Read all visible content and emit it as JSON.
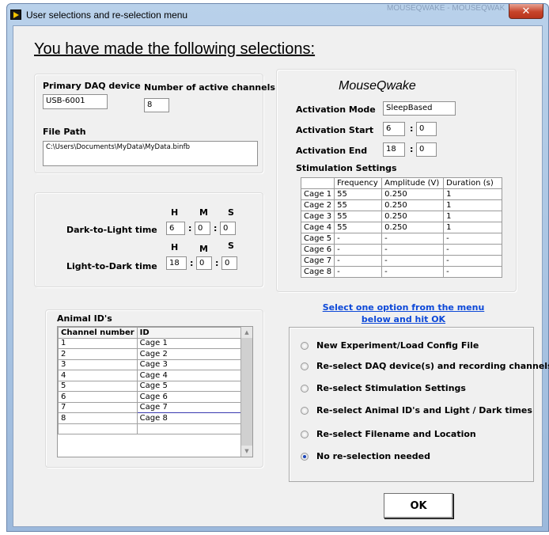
{
  "window": {
    "title": "User selections and re-selection menu",
    "background_title": "MOUSEQWAKE - MOUSEQWAKE.lvproj/..."
  },
  "heading": "You have made the following selections:",
  "daq": {
    "primary_label": "Primary DAQ device",
    "primary_value": "USB-6001",
    "channels_label": "Number of active channels",
    "channels_value": "8",
    "filepath_label": "File Path",
    "filepath_value": "C:\\Users\\Documents\\MyData\\MyData.binfb"
  },
  "times": {
    "h": "H",
    "m": "M",
    "s": "S",
    "dark_to_light_label": "Dark-to-Light time",
    "dark_to_light": {
      "h": "6",
      "m": "0",
      "s": "0"
    },
    "light_to_dark_label": "Light-to-Dark time",
    "light_to_dark": {
      "h": "18",
      "m": "0",
      "s": "0"
    }
  },
  "mousqwake": {
    "title": "MouseQwake",
    "activation_mode_label": "Activation Mode",
    "activation_mode": "SleepBased",
    "activation_start_label": "Activation Start",
    "activation_start": {
      "h": "6",
      "m": "0"
    },
    "activation_end_label": "Activation End",
    "activation_end": {
      "h": "18",
      "m": "0"
    },
    "stim_label": "Stimulation Settings",
    "stim_headers": [
      "",
      "Frequency",
      "Amplitude (V)",
      "Duration (s)"
    ],
    "stim_rows": [
      [
        "Cage 1",
        "55",
        "0.250",
        "1"
      ],
      [
        "Cage 2",
        "55",
        "0.250",
        "1"
      ],
      [
        "Cage 3",
        "55",
        "0.250",
        "1"
      ],
      [
        "Cage 4",
        "55",
        "0.250",
        "1"
      ],
      [
        "Cage 5",
        "-",
        "-",
        "-"
      ],
      [
        "Cage 6",
        "-",
        "-",
        "-"
      ],
      [
        "Cage 7",
        "-",
        "-",
        "-"
      ],
      [
        "Cage 8",
        "-",
        "-",
        "-"
      ]
    ]
  },
  "animals": {
    "label": "Animal ID's",
    "headers": [
      "Channel number",
      "ID"
    ],
    "rows": [
      [
        "1",
        "Cage 1"
      ],
      [
        "2",
        "Cage 2"
      ],
      [
        "3",
        "Cage 3"
      ],
      [
        "4",
        "Cage 4"
      ],
      [
        "5",
        "Cage 5"
      ],
      [
        "6",
        "Cage 6"
      ],
      [
        "7",
        "Cage 7"
      ],
      [
        "8",
        "Cage 8"
      ],
      [
        "",
        ""
      ]
    ]
  },
  "menu": {
    "instruction": "Select one option from the menu below and hit OK",
    "options": [
      {
        "label": "New Experiment/Load Config File",
        "selected": false
      },
      {
        "label": "Re-select DAQ device(s) and recording channels",
        "selected": false
      },
      {
        "label": "Re-select Stimulation Settings",
        "selected": false
      },
      {
        "label": "Re-select Animal ID's and Light / Dark times",
        "selected": false
      },
      {
        "label": "Re-select Filename and Location",
        "selected": false
      },
      {
        "label": "No re-selection needed",
        "selected": true
      }
    ],
    "ok_label": "OK"
  }
}
